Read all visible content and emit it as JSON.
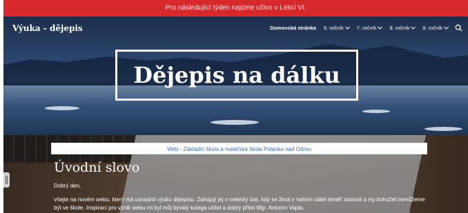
{
  "announcement": "Pro následující týden najdete učivo v Lekci VI.",
  "header": {
    "site_title": "Výuka - dějepis",
    "nav": [
      {
        "label": "Domovská stránka",
        "has_dropdown": false
      },
      {
        "label": "6. ročník",
        "has_dropdown": true
      },
      {
        "label": "7. ročník",
        "has_dropdown": true
      },
      {
        "label": "8. ročník",
        "has_dropdown": true
      },
      {
        "label": "9. ročník",
        "has_dropdown": true
      }
    ],
    "search_icon": "search-icon"
  },
  "hero": {
    "title": "Dějepis na dálku"
  },
  "content": {
    "school_bar": "Web - Základní škola a mateřská škola Polanka nad Odrou",
    "heading": "Úvodní slovo",
    "greeting": "Dobrý den,",
    "paragraph": "vítejte na novém webu, který má usnadnit výuku dějepisu. Zahajuji jej v nelehký čas, kdy se život v našem státě téměř zastavil a my bohužel nemůžeme být ve škole. Inspirací pro vznik webu mi byl můj bývalý kolega učitel a dobrý přítel Mgr. Antonín Vajda."
  },
  "colors": {
    "announcement_bg": "#d7282c",
    "link_blue": "#3d6aa6"
  }
}
